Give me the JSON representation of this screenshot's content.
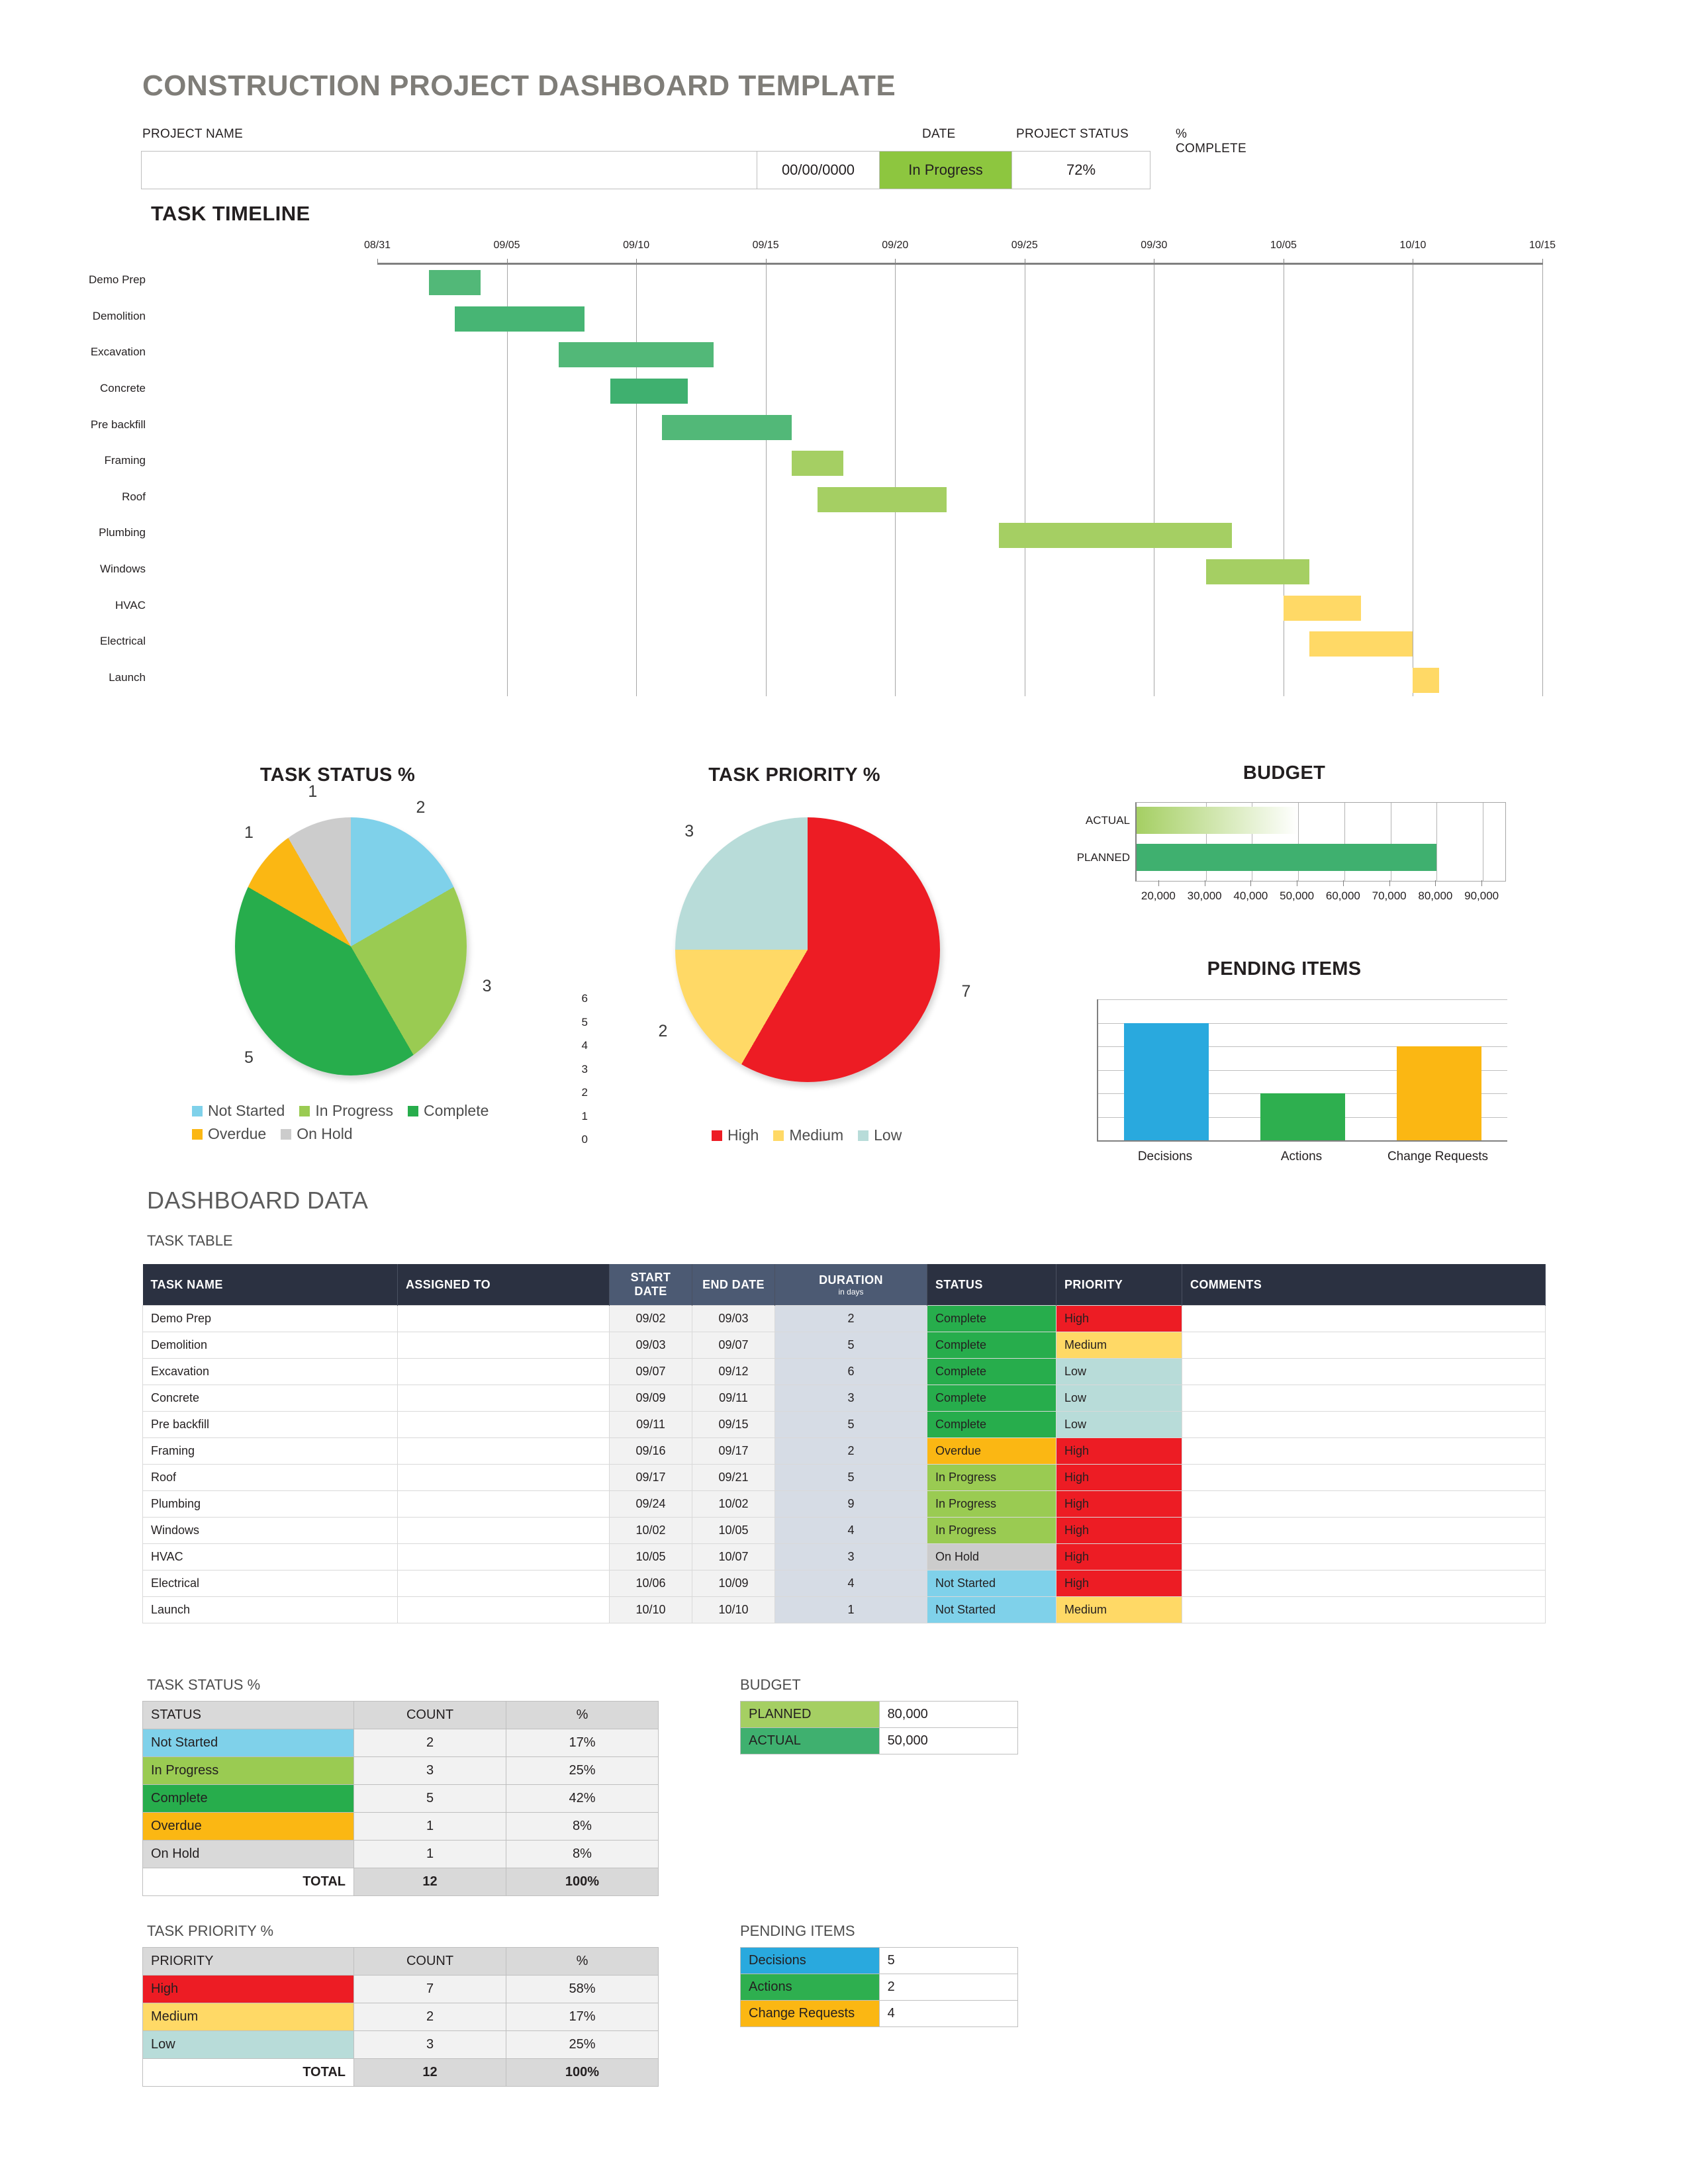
{
  "header": {
    "title": "CONSTRUCTION PROJECT DASHBOARD TEMPLATE",
    "labels": {
      "project_name": "PROJECT NAME",
      "date": "DATE",
      "project_status": "PROJECT STATUS",
      "percent_complete": "% COMPLETE"
    },
    "values": {
      "project_name": "",
      "date": "00/00/0000",
      "project_status": "In Progress",
      "percent_complete": "72%"
    },
    "status_color": "#8dc63f"
  },
  "sections": {
    "task_timeline": "TASK TIMELINE",
    "dashboard_data": "DASHBOARD DATA",
    "task_table": "TASK TABLE",
    "task_status_pct": "TASK STATUS %",
    "task_priority_pct": "TASK PRIORITY %",
    "budget": "BUDGET",
    "pending_items": "PENDING ITEMS"
  },
  "chart_data": [
    {
      "type": "bar",
      "name": "task-timeline-gantt",
      "title": "TASK TIMELINE",
      "orientation": "horizontal-gantt",
      "xlabel": "",
      "ylabel": "",
      "axis_ticks": [
        "08/31",
        "09/05",
        "09/10",
        "09/15",
        "09/20",
        "09/25",
        "09/30",
        "10/05",
        "10/10",
        "10/15"
      ],
      "axis_start": "08/31",
      "axis_end": "10/15",
      "axis_total_days": 45,
      "grid": true,
      "categories": [
        "Demo Prep",
        "Demolition",
        "Excavation",
        "Concrete",
        "Pre backfill",
        "Framing",
        "Roof",
        "Plumbing",
        "Windows",
        "HVAC",
        "Electrical",
        "Launch"
      ],
      "bars": [
        {
          "task": "Demo Prep",
          "start": "09/02",
          "end": "09/03",
          "offset_days": 2,
          "duration": 2,
          "color": "#52b878"
        },
        {
          "task": "Demolition",
          "start": "09/03",
          "end": "09/07",
          "offset_days": 3,
          "duration": 5,
          "color": "#47b574"
        },
        {
          "task": "Excavation",
          "start": "09/07",
          "end": "09/12",
          "offset_days": 7,
          "duration": 6,
          "color": "#52b878"
        },
        {
          "task": "Concrete",
          "start": "09/09",
          "end": "09/11",
          "offset_days": 9,
          "duration": 3,
          "color": "#3fb06f"
        },
        {
          "task": "Pre backfill",
          "start": "09/11",
          "end": "09/15",
          "offset_days": 11,
          "duration": 5,
          "color": "#52b878"
        },
        {
          "task": "Framing",
          "start": "09/16",
          "end": "09/17",
          "offset_days": 16,
          "duration": 2,
          "color": "#a5cf63"
        },
        {
          "task": "Roof",
          "start": "09/17",
          "end": "09/21",
          "offset_days": 17,
          "duration": 5,
          "color": "#a5cf63"
        },
        {
          "task": "Plumbing",
          "start": "09/24",
          "end": "10/02",
          "offset_days": 24,
          "duration": 9,
          "color": "#a5cf63"
        },
        {
          "task": "Windows",
          "start": "10/02",
          "end": "10/05",
          "offset_days": 32,
          "duration": 4,
          "color": "#a5cf63"
        },
        {
          "task": "HVAC",
          "start": "10/05",
          "end": "10/07",
          "offset_days": 35,
          "duration": 3,
          "color": "#ffd966"
        },
        {
          "task": "Electrical",
          "start": "10/06",
          "end": "10/09",
          "offset_days": 36,
          "duration": 4,
          "color": "#ffd966"
        },
        {
          "task": "Launch",
          "start": "10/10",
          "end": "10/10",
          "offset_days": 40,
          "duration": 1,
          "color": "#ffd966"
        }
      ]
    },
    {
      "type": "pie",
      "name": "task-status-pie",
      "title": "TASK STATUS %",
      "legend_position": "bottom",
      "labels": [
        "Not Started",
        "In Progress",
        "Complete",
        "Overdue",
        "On Hold"
      ],
      "values": [
        2,
        3,
        5,
        1,
        1
      ],
      "percents": [
        "17%",
        "25%",
        "42%",
        "8%",
        "8%"
      ],
      "colors": [
        "#7fd1ea",
        "#9acb52",
        "#27ad4c",
        "#fbb713",
        "#cccccc"
      ],
      "total": 12
    },
    {
      "type": "pie",
      "name": "task-priority-pie",
      "title": "TASK PRIORITY %",
      "legend_position": "bottom",
      "labels": [
        "High",
        "Medium",
        "Low"
      ],
      "values": [
        7,
        2,
        3
      ],
      "percents": [
        "58%",
        "17%",
        "25%"
      ],
      "colors": [
        "#ed1c24",
        "#ffd966",
        "#b8dcd9"
      ],
      "total": 12
    },
    {
      "type": "bar",
      "name": "budget-bar-chart",
      "title": "BUDGET",
      "orientation": "horizontal",
      "categories": [
        "ACTUAL",
        "PLANNED"
      ],
      "values": [
        50000,
        80000
      ],
      "colors": [
        "#a5cf63",
        "#3fb06f"
      ],
      "xlabel": "",
      "ylabel": "",
      "xlim": [
        15000,
        95000
      ],
      "xticks": [
        "20,000",
        "30,000",
        "40,000",
        "50,000",
        "60,000",
        "70,000",
        "80,000",
        "90,000"
      ],
      "grid": true
    },
    {
      "type": "bar",
      "name": "pending-items-bar-chart",
      "title": "PENDING ITEMS",
      "orientation": "vertical",
      "categories": [
        "Decisions",
        "Actions",
        "Change Requests"
      ],
      "values": [
        5,
        2,
        4
      ],
      "colors": [
        "#29a9de",
        "#2eaf4f",
        "#fbb713"
      ],
      "xlabel": "",
      "ylabel": "",
      "ylim": [
        0,
        6
      ],
      "yticks": [
        "0",
        "1",
        "2",
        "3",
        "4",
        "5",
        "6"
      ],
      "grid": true
    }
  ],
  "task_table": {
    "columns": [
      "TASK NAME",
      "ASSIGNED TO",
      "START DATE",
      "END DATE",
      "DURATION",
      "STATUS",
      "PRIORITY",
      "COMMENTS"
    ],
    "duration_sub": "in days",
    "rows": [
      {
        "task": "Demo Prep",
        "assigned": "",
        "start": "09/02",
        "end": "09/03",
        "duration": "2",
        "status": "Complete",
        "status_color": "#27ad4c",
        "priority": "High",
        "priority_color": "#ed1c24",
        "comments": ""
      },
      {
        "task": "Demolition",
        "assigned": "",
        "start": "09/03",
        "end": "09/07",
        "duration": "5",
        "status": "Complete",
        "status_color": "#27ad4c",
        "priority": "Medium",
        "priority_color": "#ffd966",
        "comments": ""
      },
      {
        "task": "Excavation",
        "assigned": "",
        "start": "09/07",
        "end": "09/12",
        "duration": "6",
        "status": "Complete",
        "status_color": "#27ad4c",
        "priority": "Low",
        "priority_color": "#b8dcd9",
        "comments": ""
      },
      {
        "task": "Concrete",
        "assigned": "",
        "start": "09/09",
        "end": "09/11",
        "duration": "3",
        "status": "Complete",
        "status_color": "#27ad4c",
        "priority": "Low",
        "priority_color": "#b8dcd9",
        "comments": ""
      },
      {
        "task": "Pre backfill",
        "assigned": "",
        "start": "09/11",
        "end": "09/15",
        "duration": "5",
        "status": "Complete",
        "status_color": "#27ad4c",
        "priority": "Low",
        "priority_color": "#b8dcd9",
        "comments": ""
      },
      {
        "task": "Framing",
        "assigned": "",
        "start": "09/16",
        "end": "09/17",
        "duration": "2",
        "status": "Overdue",
        "status_color": "#fbb713",
        "priority": "High",
        "priority_color": "#ed1c24",
        "comments": ""
      },
      {
        "task": "Roof",
        "assigned": "",
        "start": "09/17",
        "end": "09/21",
        "duration": "5",
        "status": "In Progress",
        "status_color": "#9acb52",
        "priority": "High",
        "priority_color": "#ed1c24",
        "comments": ""
      },
      {
        "task": "Plumbing",
        "assigned": "",
        "start": "09/24",
        "end": "10/02",
        "duration": "9",
        "status": "In Progress",
        "status_color": "#9acb52",
        "priority": "High",
        "priority_color": "#ed1c24",
        "comments": ""
      },
      {
        "task": "Windows",
        "assigned": "",
        "start": "10/02",
        "end": "10/05",
        "duration": "4",
        "status": "In Progress",
        "status_color": "#9acb52",
        "priority": "High",
        "priority_color": "#ed1c24",
        "comments": ""
      },
      {
        "task": "HVAC",
        "assigned": "",
        "start": "10/05",
        "end": "10/07",
        "duration": "3",
        "status": "On Hold",
        "status_color": "#cccccc",
        "priority": "High",
        "priority_color": "#ed1c24",
        "comments": ""
      },
      {
        "task": "Electrical",
        "assigned": "",
        "start": "10/06",
        "end": "10/09",
        "duration": "4",
        "status": "Not Started",
        "status_color": "#7fd1ea",
        "priority": "High",
        "priority_color": "#ed1c24",
        "comments": ""
      },
      {
        "task": "Launch",
        "assigned": "",
        "start": "10/10",
        "end": "10/10",
        "duration": "1",
        "status": "Not Started",
        "status_color": "#7fd1ea",
        "priority": "Medium",
        "priority_color": "#ffd966",
        "comments": ""
      }
    ]
  },
  "task_status_table": {
    "title": "TASK STATUS %",
    "columns": [
      "STATUS",
      "COUNT",
      "%"
    ],
    "rows": [
      {
        "label": "Not Started",
        "count": "2",
        "pct": "17%",
        "color": "#7fd1ea"
      },
      {
        "label": "In Progress",
        "count": "3",
        "pct": "25%",
        "color": "#9acb52"
      },
      {
        "label": "Complete",
        "count": "5",
        "pct": "42%",
        "color": "#27ad4c"
      },
      {
        "label": "Overdue",
        "count": "1",
        "pct": "8%",
        "color": "#fbb713"
      },
      {
        "label": "On Hold",
        "count": "1",
        "pct": "8%",
        "color": "#d9d9d9"
      }
    ],
    "total_label": "TOTAL",
    "total_count": "12",
    "total_pct": "100%"
  },
  "task_priority_table": {
    "title": "TASK PRIORITY %",
    "columns": [
      "PRIORITY",
      "COUNT",
      "%"
    ],
    "rows": [
      {
        "label": "High",
        "count": "7",
        "pct": "58%",
        "color": "#ed1c24"
      },
      {
        "label": "Medium",
        "count": "2",
        "pct": "17%",
        "color": "#ffd966"
      },
      {
        "label": "Low",
        "count": "3",
        "pct": "25%",
        "color": "#b8dcd9"
      }
    ],
    "total_label": "TOTAL",
    "total_count": "12",
    "total_pct": "100%"
  },
  "budget_table": {
    "title": "BUDGET",
    "rows": [
      {
        "label": "PLANNED",
        "value": "80,000",
        "color": "#a5cf63"
      },
      {
        "label": "ACTUAL",
        "value": "50,000",
        "color": "#3fb06f"
      }
    ]
  },
  "pending_items_table": {
    "title": "PENDING ITEMS",
    "rows": [
      {
        "label": "Decisions",
        "value": "5",
        "color": "#29a9de"
      },
      {
        "label": "Actions",
        "value": "2",
        "color": "#2eaf4f"
      },
      {
        "label": "Change Requests",
        "value": "4",
        "color": "#fbb713"
      }
    ]
  }
}
